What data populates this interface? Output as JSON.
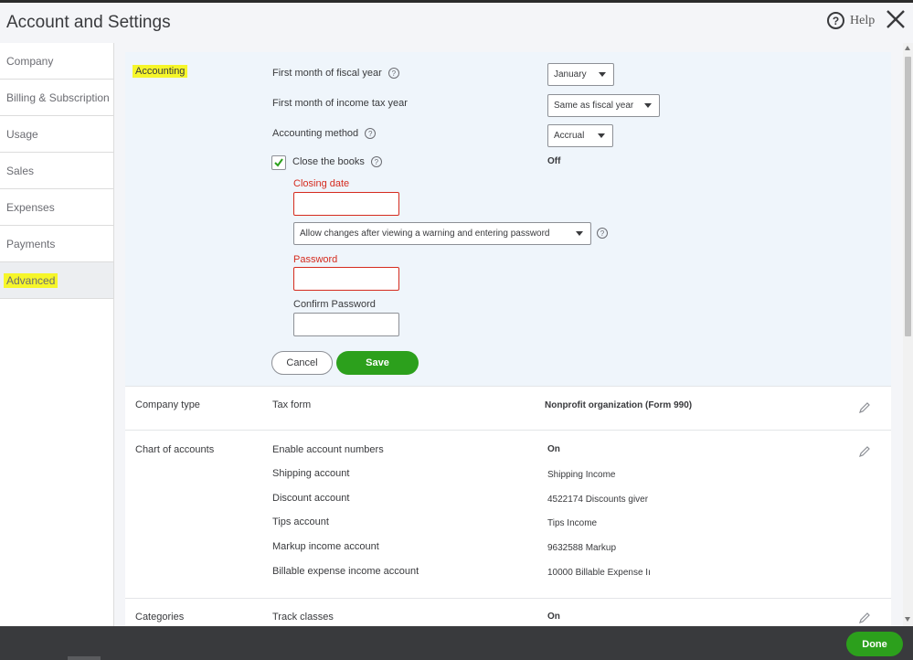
{
  "header": {
    "title": "Account and Settings",
    "help_label": "Help",
    "help_glyph": "?",
    "close_icon": "close-icon"
  },
  "sidebar": {
    "items": [
      {
        "label": "Company"
      },
      {
        "label": "Billing & Subscription"
      },
      {
        "label": "Usage"
      },
      {
        "label": "Sales"
      },
      {
        "label": "Expenses"
      },
      {
        "label": "Payments"
      },
      {
        "label": "Advanced",
        "active": true
      }
    ],
    "highlight_color": "#f6f62a"
  },
  "accounting": {
    "section_label": "Accounting",
    "fiscal_year": {
      "label": "First month of fiscal year",
      "value": "January"
    },
    "income_tax_year": {
      "label": "First month of income tax year",
      "value": "Same as fiscal year"
    },
    "accounting_method": {
      "label": "Accounting method",
      "value": "Accrual"
    },
    "close_books": {
      "label": "Close the books",
      "status": "Off",
      "checked": true,
      "check_glyph": "✓"
    },
    "closing_date": {
      "label": "Closing date",
      "value": ""
    },
    "allow_changes": {
      "value": "Allow changes after viewing a warning and entering password"
    },
    "password": {
      "label": "Password",
      "value": ""
    },
    "confirm_password": {
      "label": "Confirm Password",
      "value": ""
    },
    "cancel_label": "Cancel",
    "save_label": "Save",
    "help_glyph": "?"
  },
  "company_type": {
    "section_label": "Company type",
    "rows": [
      {
        "label": "Tax form",
        "value": "Nonprofit organization (Form 990)"
      }
    ]
  },
  "chart_of_accounts": {
    "section_label": "Chart of accounts",
    "rows": [
      {
        "label": "Enable account numbers",
        "value": "On"
      },
      {
        "label": "Shipping account",
        "value": "Shipping Income"
      },
      {
        "label": "Discount account",
        "value": "4522174 Discounts giver"
      },
      {
        "label": "Tips account",
        "value": "Tips Income"
      },
      {
        "label": "Markup income account",
        "value": "9632588 Markup"
      },
      {
        "label": "Billable expense income account",
        "value": "10000 Billable Expense Iı"
      }
    ]
  },
  "categories": {
    "section_label": "Categories",
    "rows": [
      {
        "label": "Track classes",
        "value": "On"
      }
    ]
  },
  "footer": {
    "done_label": "Done"
  },
  "colors": {
    "accent_green": "#2ca01c",
    "error_red": "#d52b1e",
    "footer_bg": "#393a3d"
  }
}
